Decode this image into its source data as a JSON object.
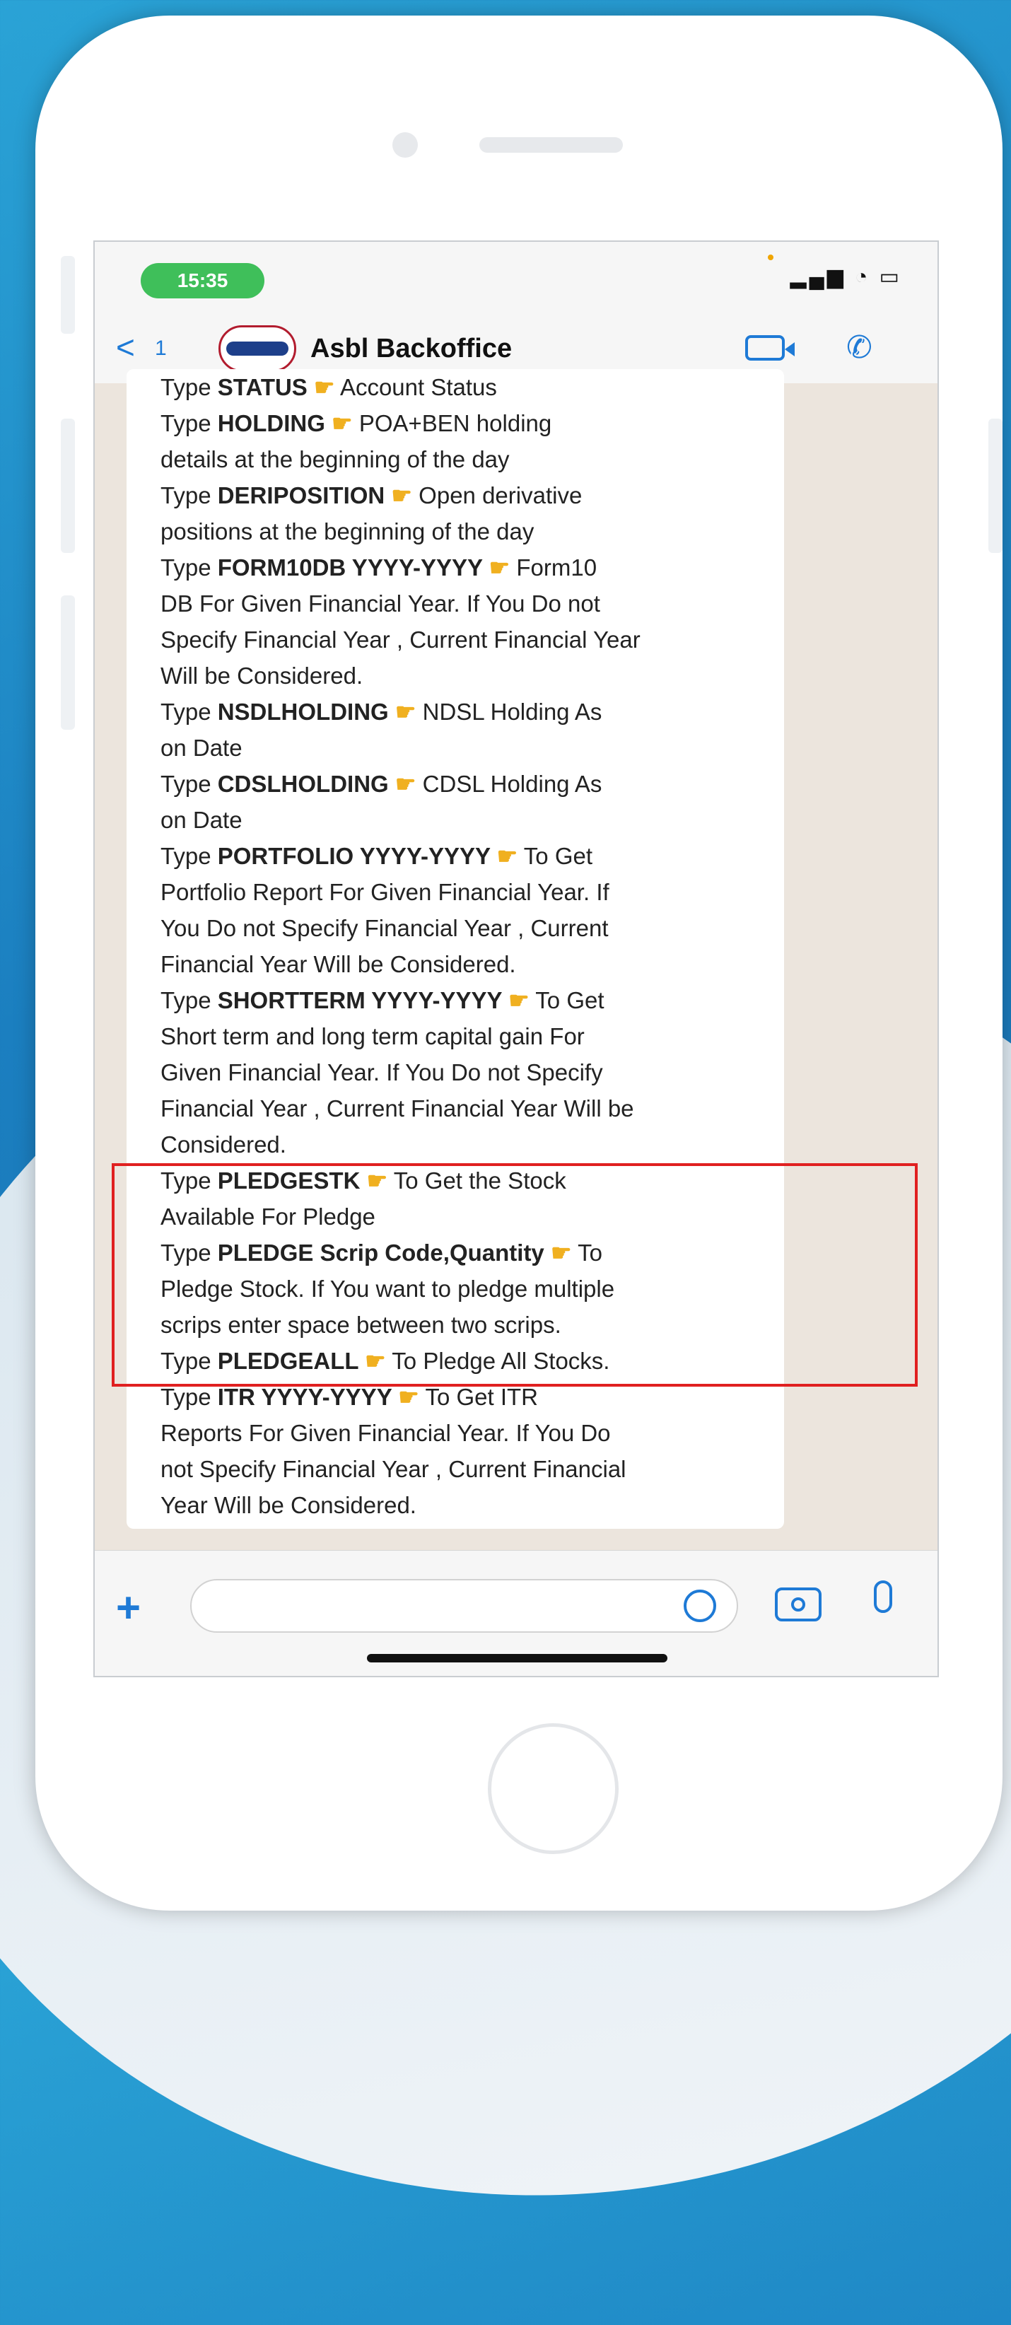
{
  "status_bar": {
    "time": "15:35",
    "icons": "▂▄▆ ◔ ▭"
  },
  "header": {
    "back_glyph": "<",
    "back_count": "1",
    "contact_name": "Asbl Backoffice"
  },
  "message": {
    "pointer_glyph": "👉",
    "lines": [
      {
        "pre": "Type ",
        "bold": "STATUS",
        "post": "    Account Status",
        "ptr": true
      },
      {
        "pre": "Type ",
        "bold": "HOLDING",
        "post": "    POA+BEN holding",
        "ptr": true
      },
      {
        "pre": "details at the beginning of the day",
        "bold": "",
        "post": "",
        "ptr": false
      },
      {
        "pre": "Type ",
        "bold": "DERIPOSITION",
        "post": "    Open derivative",
        "ptr": true
      },
      {
        "pre": "positions at the beginning of the day",
        "bold": "",
        "post": "",
        "ptr": false
      },
      {
        "pre": "Type ",
        "bold": "FORM10DB YYYY-YYYY",
        "post": "    Form10",
        "ptr": true
      },
      {
        "pre": "DB For Given Financial Year. If You Do not",
        "bold": "",
        "post": "",
        "ptr": false
      },
      {
        "pre": "Specify Financial Year , Current Financial Year",
        "bold": "",
        "post": "",
        "ptr": false
      },
      {
        "pre": "Will be Considered.",
        "bold": "",
        "post": "",
        "ptr": false
      },
      {
        "pre": "Type ",
        "bold": "NSDLHOLDING",
        "post": "    NDSL Holding As",
        "ptr": true
      },
      {
        "pre": "on Date",
        "bold": "",
        "post": "",
        "ptr": false
      },
      {
        "pre": "Type ",
        "bold": "CDSLHOLDING",
        "post": "    CDSL Holding As",
        "ptr": true
      },
      {
        "pre": "on Date",
        "bold": "",
        "post": "",
        "ptr": false
      },
      {
        "pre": "Type ",
        "bold": "PORTFOLIO YYYY-YYYY",
        "post": "    To Get",
        "ptr": true
      },
      {
        "pre": "Portfolio Report For Given Financial Year. If",
        "bold": "",
        "post": "",
        "ptr": false
      },
      {
        "pre": "You Do not Specify Financial Year , Current",
        "bold": "",
        "post": "",
        "ptr": false
      },
      {
        "pre": "Financial Year Will be Considered.",
        "bold": "",
        "post": "",
        "ptr": false
      },
      {
        "pre": "Type ",
        "bold": "SHORTTERM YYYY-YYYY",
        "post": "    To Get",
        "ptr": true
      },
      {
        "pre": "Short term and long term capital gain For",
        "bold": "",
        "post": "",
        "ptr": false
      },
      {
        "pre": "Given Financial Year. If You Do not Specify",
        "bold": "",
        "post": "",
        "ptr": false
      },
      {
        "pre": "Financial Year , Current Financial Year Will be",
        "bold": "",
        "post": "",
        "ptr": false
      },
      {
        "pre": "Considered.",
        "bold": "",
        "post": "",
        "ptr": false
      },
      {
        "pre": "Type ",
        "bold": "PLEDGESTK",
        "post": "    To Get the Stock",
        "ptr": true
      },
      {
        "pre": "Available For Pledge",
        "bold": "",
        "post": "",
        "ptr": false
      },
      {
        "pre": "Type ",
        "bold": "PLEDGE Scrip Code,Quantity",
        "post": "    To",
        "ptr": true
      },
      {
        "pre": "Pledge Stock. If You want to pledge multiple",
        "bold": "",
        "post": "",
        "ptr": false
      },
      {
        "pre": "scrips enter space between two scrips.",
        "bold": "",
        "post": "",
        "ptr": false
      },
      {
        "pre": "Type ",
        "bold": "PLEDGEALL",
        "post": "    To Pledge All Stocks.",
        "ptr": true
      },
      {
        "pre": "Type ",
        "bold": "ITR YYYY-YYYY",
        "post": "    To Get ITR",
        "ptr": true
      },
      {
        "pre": "Reports For Given Financial Year. If You Do",
        "bold": "",
        "post": "",
        "ptr": false
      },
      {
        "pre": "not Specify Financial Year , Current Financial",
        "bold": "",
        "post": "",
        "ptr": false
      },
      {
        "pre": "Year Will be Considered.",
        "bold": "",
        "post": "",
        "ptr": false
      }
    ]
  },
  "input_bar": {
    "plus_glyph": "+",
    "message_value": ""
  },
  "colors": {
    "accent": "#1e7ad6",
    "highlight": "#e02020",
    "time_pill": "#3fbf5a"
  }
}
